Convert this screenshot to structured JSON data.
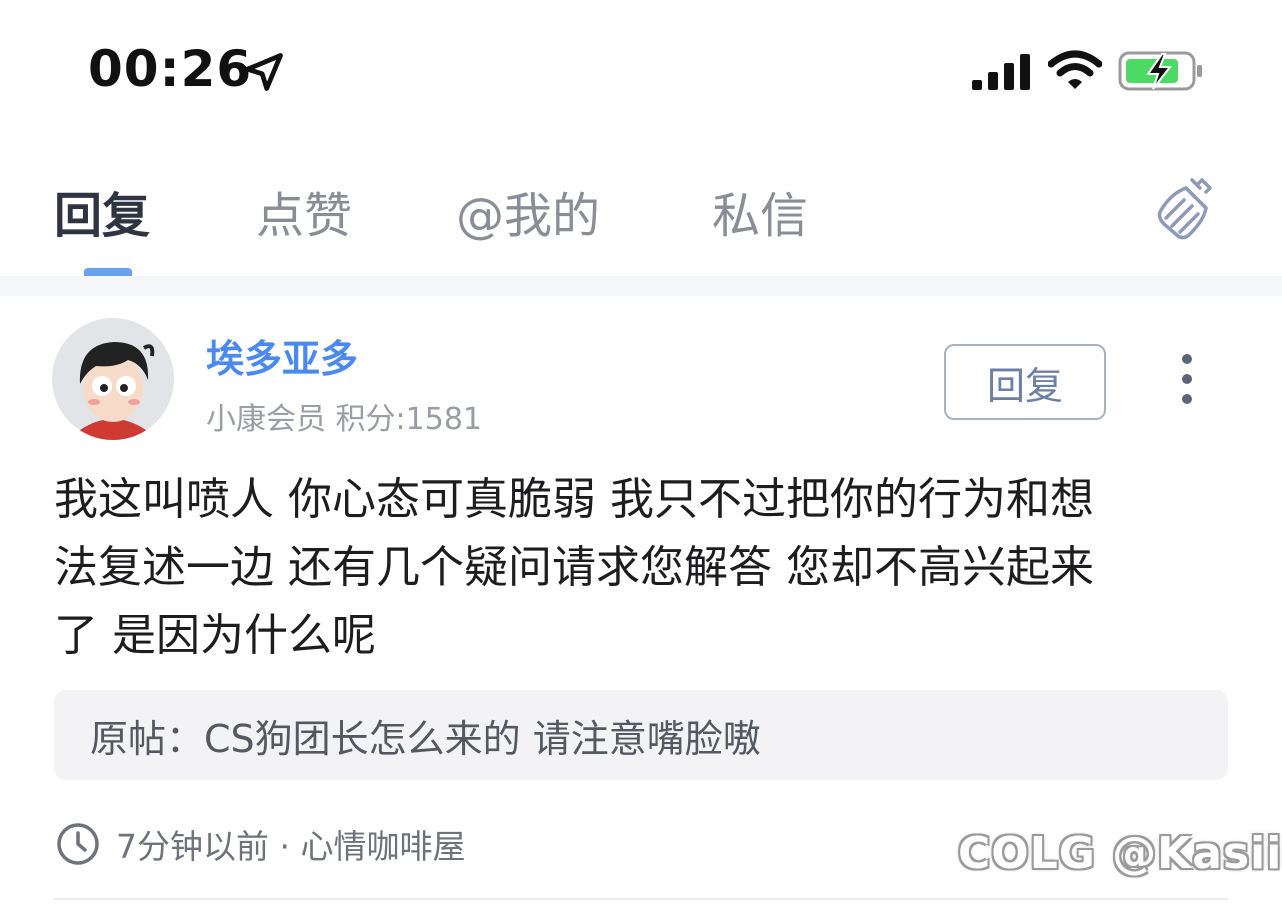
{
  "status_bar": {
    "time": "00:26",
    "icons": [
      "location-arrow-icon",
      "cellular-signal-icon",
      "wifi-icon",
      "battery-charging-icon"
    ]
  },
  "tabs": [
    {
      "label": "回复",
      "active": true
    },
    {
      "label": "点赞",
      "active": false
    },
    {
      "label": "@我的",
      "active": false
    },
    {
      "label": "私信",
      "active": false
    }
  ],
  "tab_icon": "broom-icon",
  "post": {
    "username": "埃多亚多",
    "user_meta": "小康会员 积分:1581",
    "reply_button": "回复",
    "more_icon": "more-vertical-icon",
    "content_lines": [
      "我这叫喷人  你心态可真脆弱  我只不过把你的行为和想",
      "法复述一边  还有几个疑问请求您解答  您却不高兴起来",
      "了 是因为什么呢"
    ],
    "original_post": "原帖：CS狗团长怎么来的 请注意嘴脸嗷",
    "footer": "7分钟以前 · 心情咖啡屋"
  },
  "watermark": "COLG @Kasiily",
  "colors": {
    "accent": "#4a8af0",
    "tab_indicator": "#6aa2f0",
    "battery_green": "#4cd964"
  }
}
